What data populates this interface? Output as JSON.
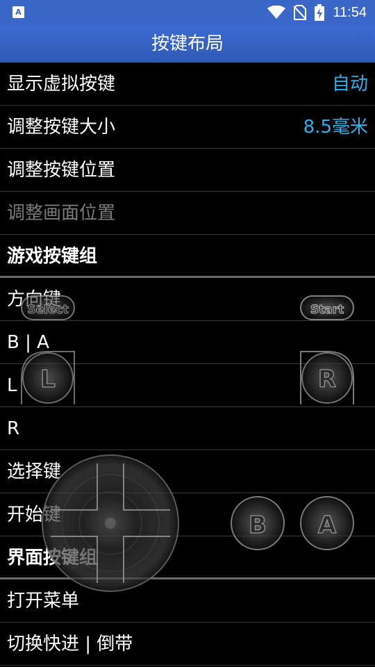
{
  "status_bar": {
    "time": "11:54",
    "left_icon": "A",
    "icons": [
      "wifi-icon",
      "no-sim-icon",
      "battery-charging-icon"
    ]
  },
  "app_bar": {
    "title": "按键布局"
  },
  "settings": [
    {
      "label": "显示虚拟按键",
      "value": "自动"
    },
    {
      "label": "调整按键大小",
      "value": "8.5毫米"
    },
    {
      "label": "调整按键位置"
    },
    {
      "label": "调整画面位置"
    },
    {
      "label": "游戏按键组"
    },
    {
      "label": "方向键"
    },
    {
      "label": "B | A"
    },
    {
      "label": "L"
    },
    {
      "label": "R"
    },
    {
      "label": "选择键"
    },
    {
      "label": "开始键"
    },
    {
      "label": "界面按键组"
    },
    {
      "label": "打开菜单"
    },
    {
      "label": "切换快进 | 倒带"
    }
  ],
  "virtual_buttons": {
    "select": "Select",
    "start": "Start",
    "l": "L",
    "r": "R",
    "b": "B",
    "a": "A"
  },
  "colors": {
    "status_bar": "#3a67c8",
    "accent": "#2bb1ea",
    "background": "#000000"
  }
}
